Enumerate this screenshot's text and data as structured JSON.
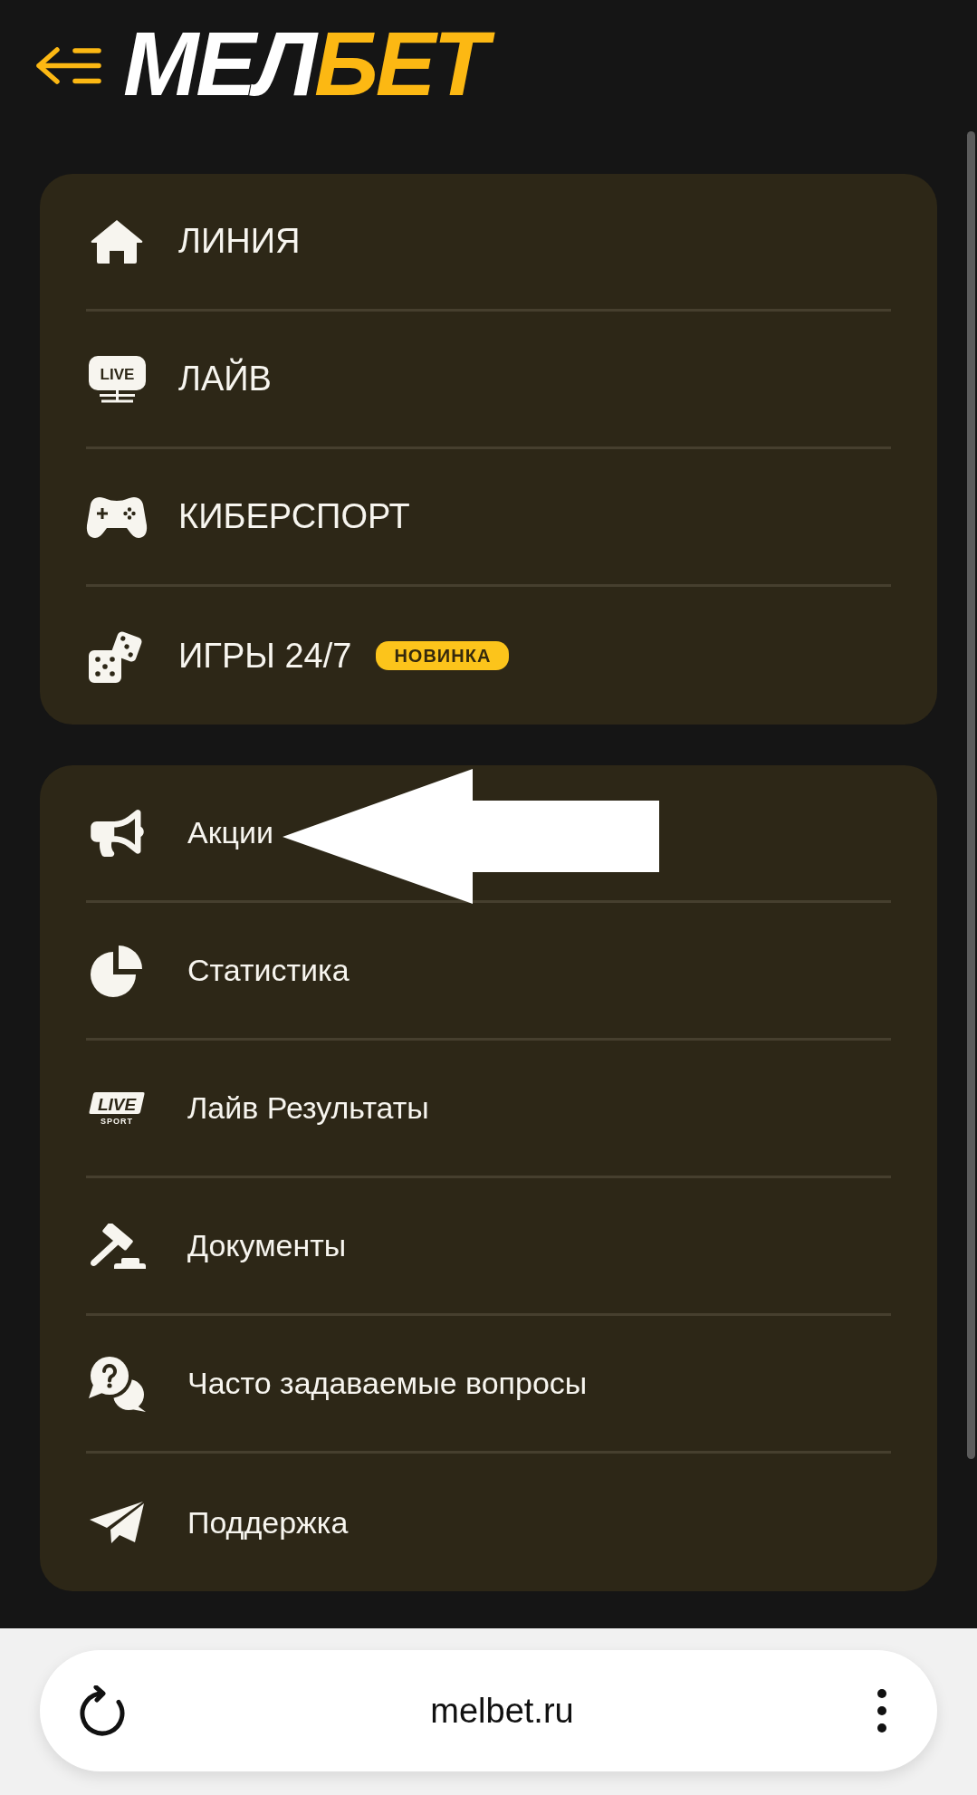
{
  "header": {
    "logo": {
      "text": "МЕЛ",
      "accent_text": "БЕТ"
    }
  },
  "main_menu": {
    "items": [
      {
        "label": "ЛИНИЯ"
      },
      {
        "label": "ЛАЙВ",
        "icon_text": "LIVE"
      },
      {
        "label": "КИБЕРСПОРТ"
      },
      {
        "label": "ИГРЫ 24/7",
        "badge": "НОВИНКА"
      }
    ]
  },
  "more_menu": {
    "items": [
      {
        "label": "Акции"
      },
      {
        "label": "Статистика"
      },
      {
        "label": "Лайв Результаты",
        "icon_text": "LIVE",
        "icon_subtext": "SPORT"
      },
      {
        "label": "Документы"
      },
      {
        "label": "Часто задаваемые вопросы"
      },
      {
        "label": "Поддержка"
      }
    ]
  },
  "browser_bar": {
    "url": "melbet.ru"
  }
}
